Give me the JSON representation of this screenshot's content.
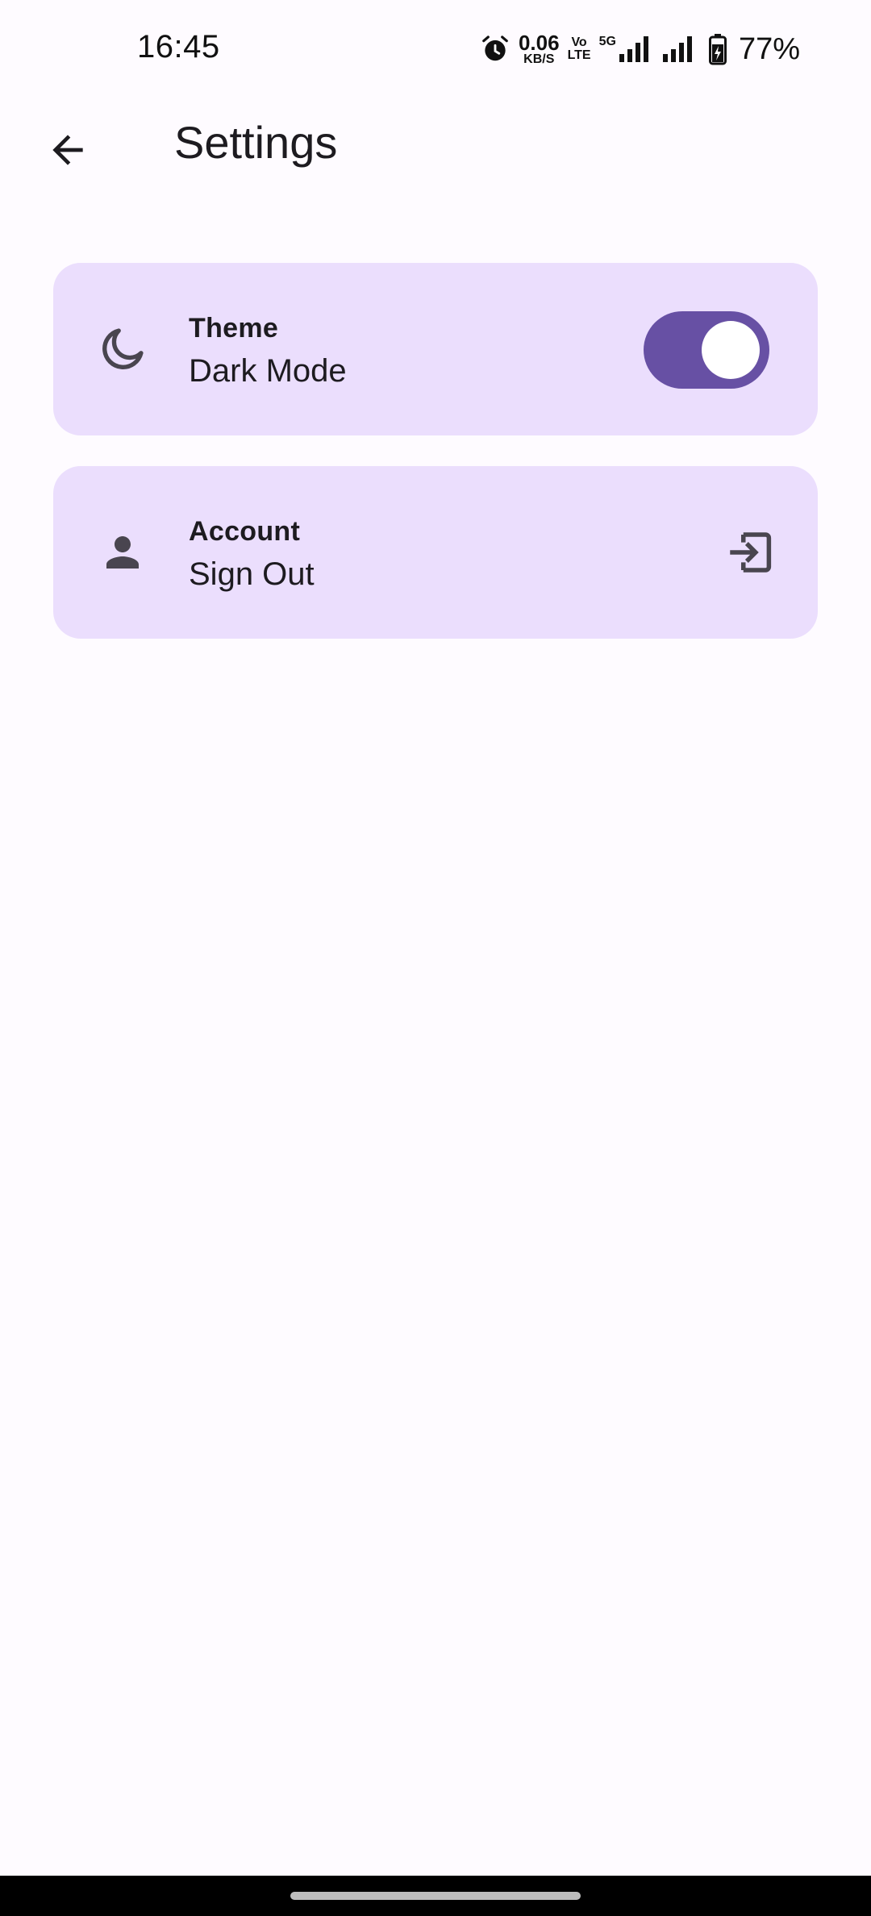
{
  "status_bar": {
    "time": "16:45",
    "net_speed_value": "0.06",
    "net_speed_unit": "KB/S",
    "volte_top": "Vo",
    "volte_bottom": "LTE",
    "network_label": "5G",
    "battery_percent": "77%"
  },
  "app_bar": {
    "title": "Settings",
    "back_icon": "arrow-back-icon"
  },
  "settings": [
    {
      "title": "Theme",
      "subtitle": "Dark Mode",
      "icon": "moon-icon",
      "control": "toggle",
      "toggle_on": true
    },
    {
      "title": "Account",
      "subtitle": "Sign Out",
      "icon": "person-icon",
      "trailing_icon": "logout-icon"
    }
  ],
  "colors": {
    "background": "#fefbff",
    "card_background": "#ebdefd",
    "toggle_track": "#6750a4",
    "toggle_thumb": "#ffffff",
    "icon": "#49454f",
    "text": "#1d1b20"
  }
}
